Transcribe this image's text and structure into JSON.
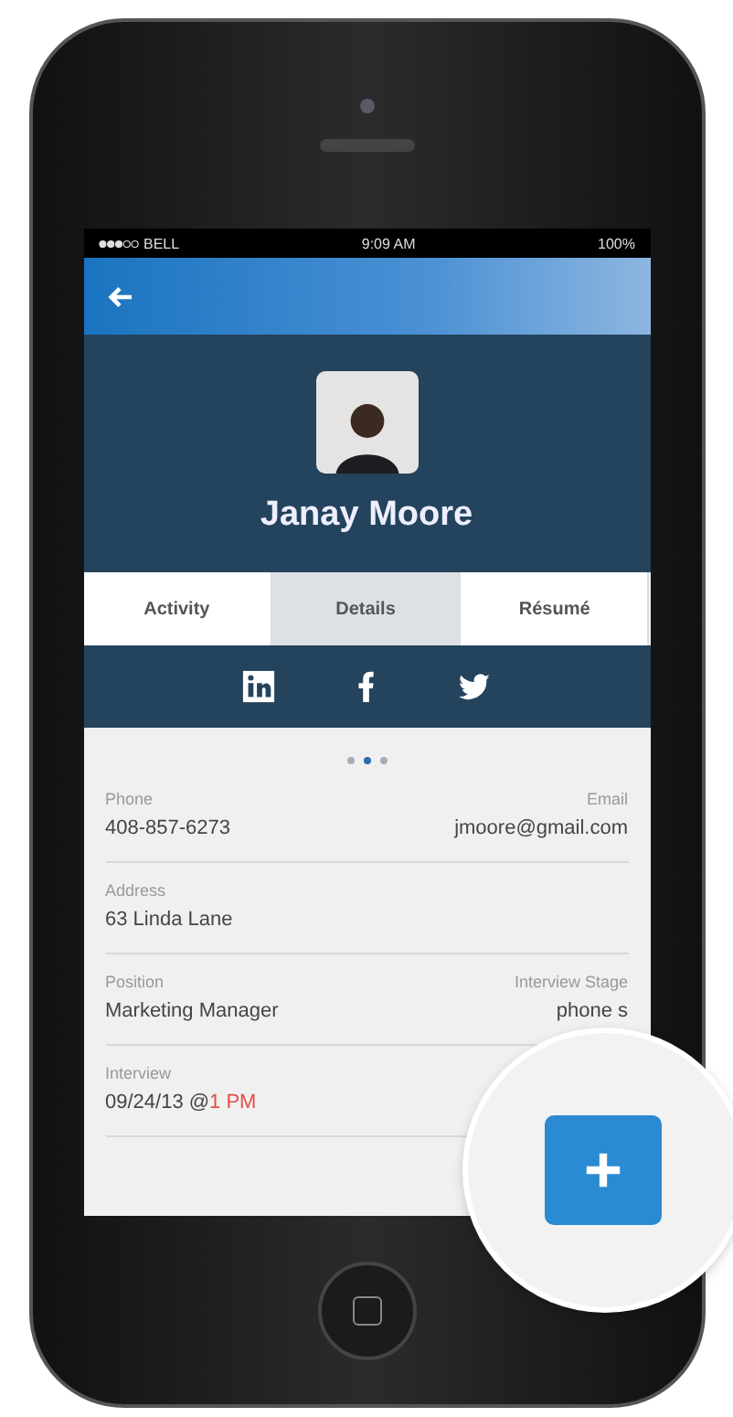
{
  "status_bar": {
    "carrier": "BELL",
    "time": "9:09 AM",
    "battery": "100%"
  },
  "profile": {
    "name": "Janay Moore"
  },
  "tabs": [
    {
      "label": "Activity",
      "selected": false
    },
    {
      "label": "Details",
      "selected": true
    },
    {
      "label": "Résumé",
      "selected": false
    }
  ],
  "social": [
    {
      "kind": "linkedin"
    },
    {
      "kind": "facebook"
    },
    {
      "kind": "twitter"
    }
  ],
  "page_dots": [
    {
      "selected": false
    },
    {
      "selected": true
    },
    {
      "selected": false
    }
  ],
  "fields": [
    {
      "left_label": "Phone",
      "left_value": "408-857-6273",
      "right_label": "Email",
      "right_value": "jmoore@gmail.com"
    },
    {
      "left_label": "Address",
      "left_value": "63 Linda Lane"
    },
    {
      "left_label": "Position",
      "left_value": "Marketing Manager",
      "right_label": "Interview Stage",
      "right_value": "phone s"
    },
    {
      "left_label": "Interview",
      "left_value": "09/24/13 @",
      "left_highlight": "1 PM"
    }
  ]
}
